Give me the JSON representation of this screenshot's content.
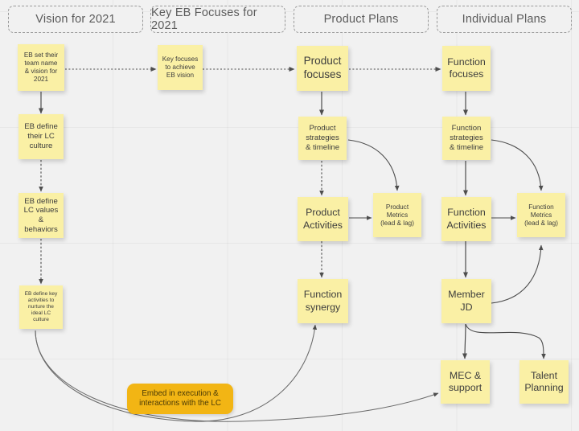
{
  "board": {
    "background_color": "#f1f1f1",
    "note_color": "#faf0a5",
    "highlight_note_color": "#f2b514",
    "connector_color": "#4d4d4d"
  },
  "lanes": [
    {
      "id": "vision",
      "label": "Vision for 2021"
    },
    {
      "id": "eb_focuses",
      "label": "Key EB Focuses for 2021"
    },
    {
      "id": "product",
      "label": "Product Plans"
    },
    {
      "id": "individual",
      "label": "Individual Plans"
    }
  ],
  "notes": [
    {
      "id": "n1",
      "lane": "vision",
      "text": "EB set their team name & vision for 2021"
    },
    {
      "id": "n2",
      "lane": "vision",
      "text": "EB define their LC culture"
    },
    {
      "id": "n3",
      "lane": "vision",
      "text": "EB define LC values & behaviors"
    },
    {
      "id": "n4",
      "lane": "vision",
      "text": "EB define key activities to nurture the ideal LC culture"
    },
    {
      "id": "n5",
      "lane": "eb_focuses",
      "text": "Key focuses to achieve EB vision"
    },
    {
      "id": "n6",
      "lane": "product",
      "text": "Product focuses"
    },
    {
      "id": "n7",
      "lane": "product",
      "text": "Product strategies & timeline"
    },
    {
      "id": "n8",
      "lane": "product",
      "text": "Product Activities"
    },
    {
      "id": "n9",
      "lane": "product",
      "text": "Product Metrics (lead & lag)"
    },
    {
      "id": "n10",
      "lane": "product",
      "text": "Function synergy"
    },
    {
      "id": "n11",
      "lane": "individual",
      "text": "Function focuses"
    },
    {
      "id": "n12",
      "lane": "individual",
      "text": "Function strategies & timeline"
    },
    {
      "id": "n13",
      "lane": "individual",
      "text": "Function Activities"
    },
    {
      "id": "n14",
      "lane": "individual",
      "text": "Function Metrics (lead & lag)"
    },
    {
      "id": "n15",
      "lane": "individual",
      "text": "Member JD"
    },
    {
      "id": "n16",
      "lane": "individual",
      "text": "MEC & support"
    },
    {
      "id": "n17",
      "lane": "individual",
      "text": "Talent Planning"
    },
    {
      "id": "n18",
      "lane": "vision",
      "text": "Embed in execution & interactions with the LC"
    }
  ],
  "note_lines": {
    "n1": [
      "EB set their",
      "team name",
      "& vision for",
      "2021"
    ],
    "n2": [
      "EB define",
      "their LC",
      "culture"
    ],
    "n3": [
      "EB define",
      "LC values &",
      "behaviors"
    ],
    "n4": [
      "EB define key",
      "activities to",
      "nurture the",
      "ideal LC",
      "culture"
    ],
    "n5": [
      "Key focuses",
      "to achieve",
      "EB vision"
    ],
    "n6": [
      "Product",
      "focuses"
    ],
    "n7": [
      "Product",
      "strategies",
      "& timeline"
    ],
    "n8": [
      "Product",
      "Activities"
    ],
    "n9": [
      "Product",
      "Metrics",
      "(lead & lag)"
    ],
    "n10": [
      "Function",
      "synergy"
    ],
    "n11": [
      "Function",
      "focuses"
    ],
    "n12": [
      "Function",
      "strategies",
      "& timeline"
    ],
    "n13": [
      "Function",
      "Activities"
    ],
    "n14": [
      "Function",
      "Metrics",
      "(lead & lag)"
    ],
    "n15": [
      "Member",
      "JD"
    ],
    "n16": [
      "MEC &",
      "support"
    ],
    "n17": [
      "Talent",
      "Planning"
    ],
    "n18": [
      "Embed in execution &",
      "interactions with the LC"
    ]
  },
  "connections": [
    {
      "from": "n1",
      "to": "n5",
      "style": "dotted"
    },
    {
      "from": "n5",
      "to": "n6",
      "style": "dotted"
    },
    {
      "from": "n6",
      "to": "n11",
      "style": "dotted"
    },
    {
      "from": "n1",
      "to": "n2",
      "style": "solid"
    },
    {
      "from": "n2",
      "to": "n3",
      "style": "solid"
    },
    {
      "from": "n3",
      "to": "n4",
      "style": "dotted"
    },
    {
      "from": "n6",
      "to": "n7",
      "style": "solid"
    },
    {
      "from": "n7",
      "to": "n8",
      "style": "dotted"
    },
    {
      "from": "n7",
      "to": "n9",
      "style": "curved"
    },
    {
      "from": "n8",
      "to": "n9",
      "style": "solid"
    },
    {
      "from": "n8",
      "to": "n10",
      "style": "dotted"
    },
    {
      "from": "n11",
      "to": "n12",
      "style": "solid"
    },
    {
      "from": "n12",
      "to": "n13",
      "style": "solid"
    },
    {
      "from": "n12",
      "to": "n14",
      "style": "curved"
    },
    {
      "from": "n13",
      "to": "n14",
      "style": "solid"
    },
    {
      "from": "n13",
      "to": "n15",
      "style": "solid"
    },
    {
      "from": "n15",
      "to": "n14",
      "style": "curved"
    },
    {
      "from": "n15",
      "to": "n16",
      "style": "solid"
    },
    {
      "from": "n15",
      "to": "n17",
      "style": "curved"
    },
    {
      "from": "n4",
      "to": "n10",
      "style": "curved"
    },
    {
      "from": "n4",
      "to": "n16",
      "style": "curved"
    }
  ]
}
